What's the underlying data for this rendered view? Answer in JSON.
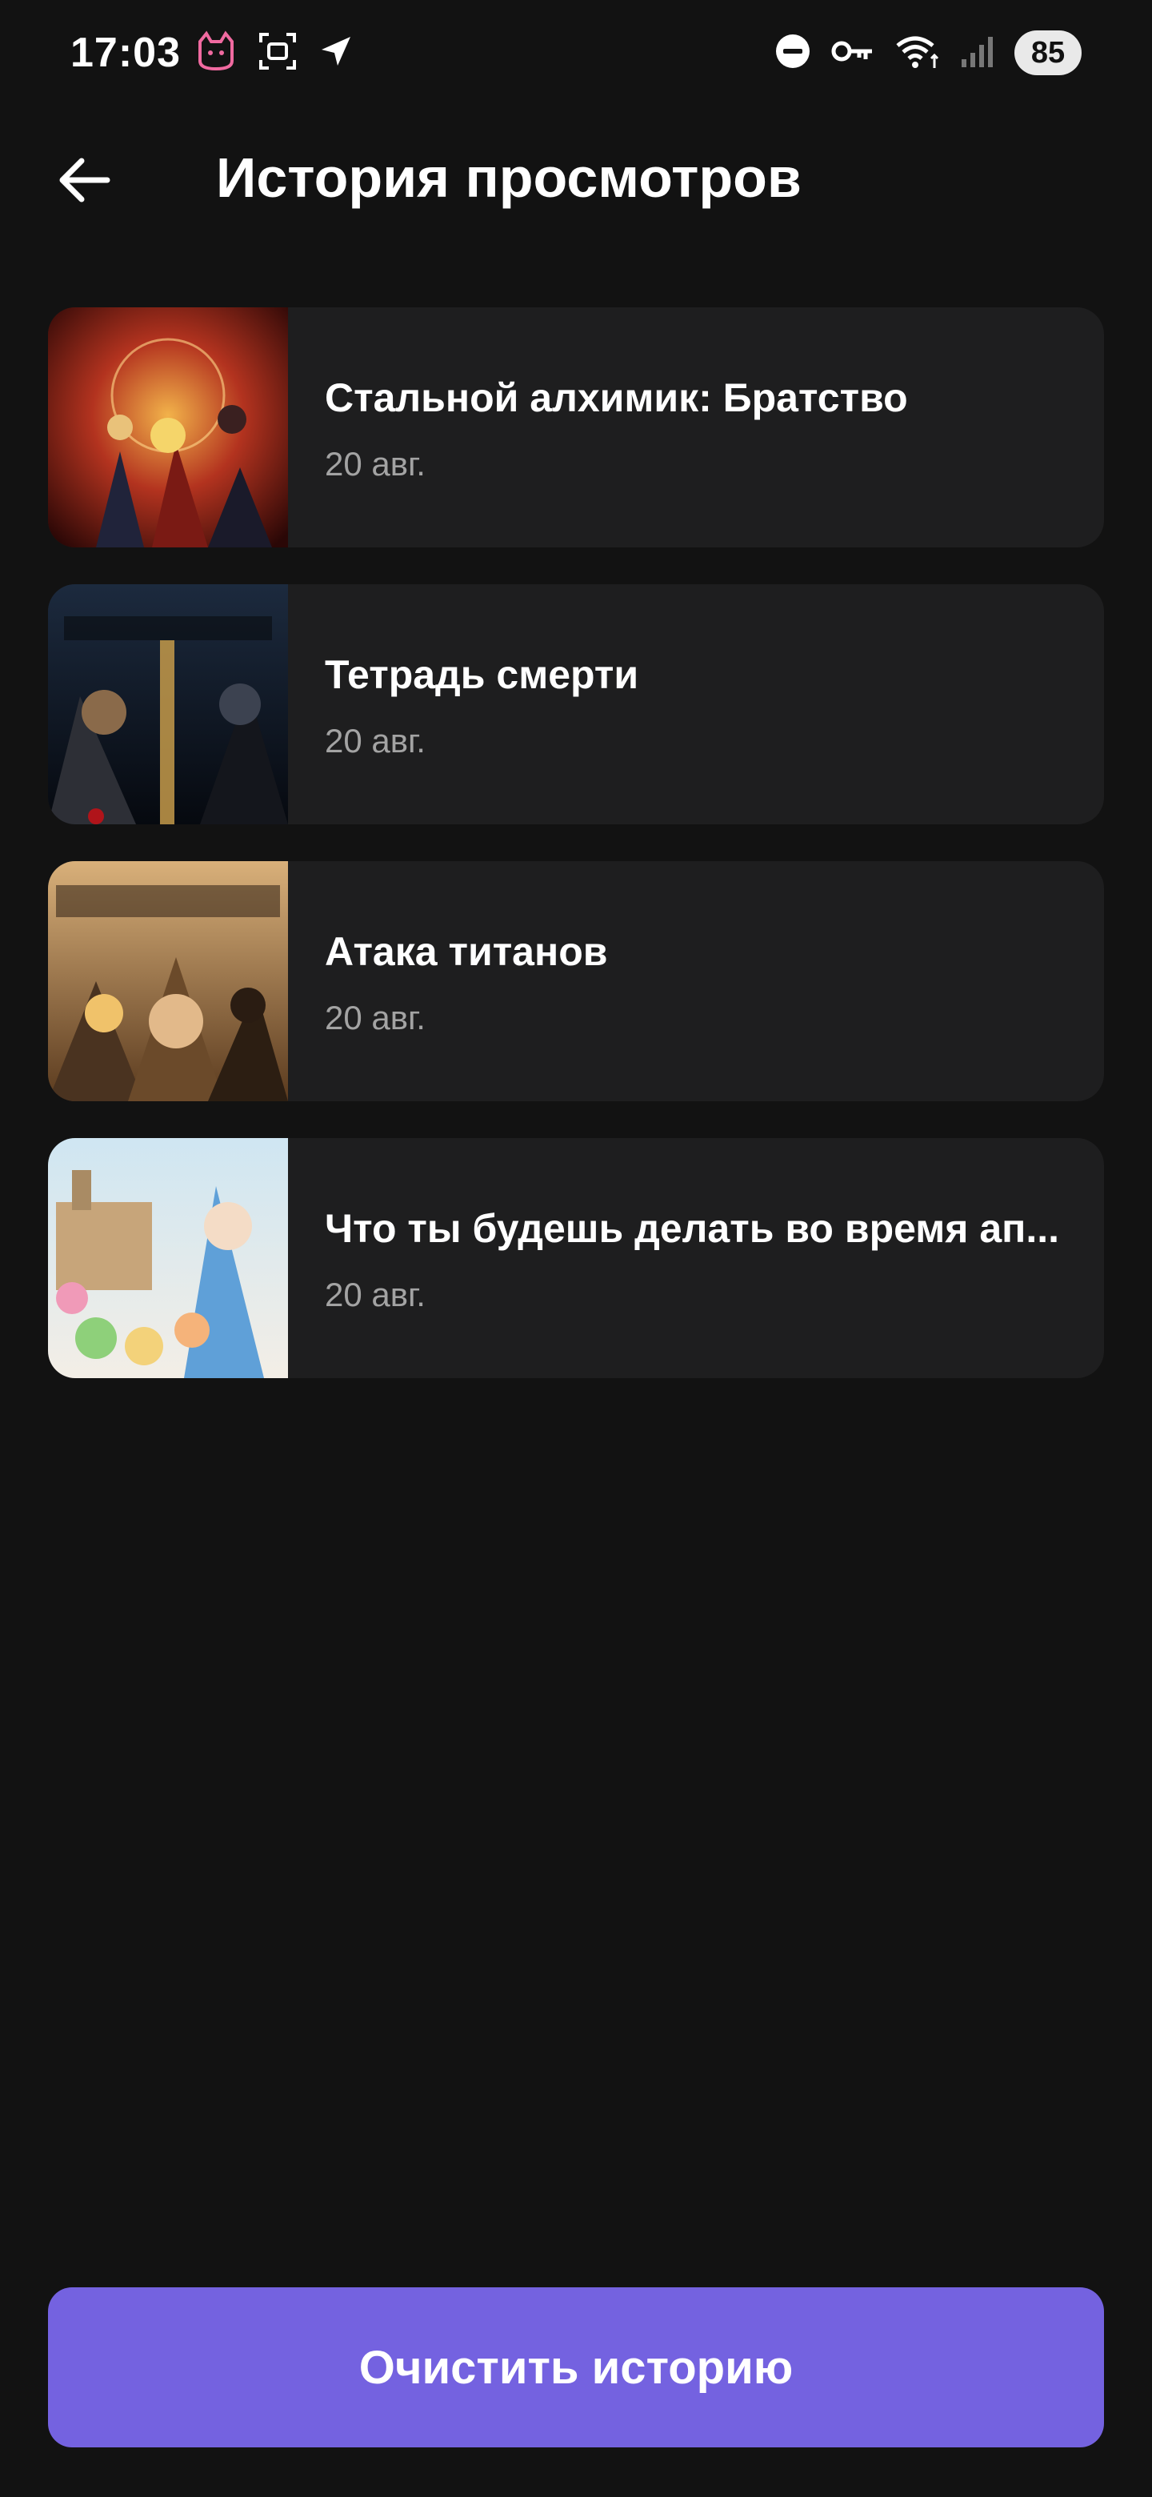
{
  "status_bar": {
    "time": "17:03",
    "battery": "85",
    "icons_left": [
      "cat-notification-icon",
      "screenshot-icon",
      "location-arrow-icon"
    ],
    "icons_right": [
      "do-not-disturb-icon",
      "vpn-key-icon",
      "wifi-icon",
      "signal-icon"
    ]
  },
  "header": {
    "title": "История просмотров",
    "back_icon": "arrow-left-icon"
  },
  "history": {
    "items": [
      {
        "title": "Стальной алхимик: Братство",
        "date": "20 авг."
      },
      {
        "title": "Тетрадь смерти",
        "date": "20 авг."
      },
      {
        "title": "Атака титанов",
        "date": "20 авг."
      },
      {
        "title": "Что ты будешь делать во время ап...",
        "date": "20 авг."
      }
    ]
  },
  "footer": {
    "clear_label": "Очистить историю"
  },
  "colors": {
    "background": "#121212",
    "card": "#1e1e1f",
    "accent": "#7462e0",
    "secondary_text": "#a3a3a3"
  }
}
